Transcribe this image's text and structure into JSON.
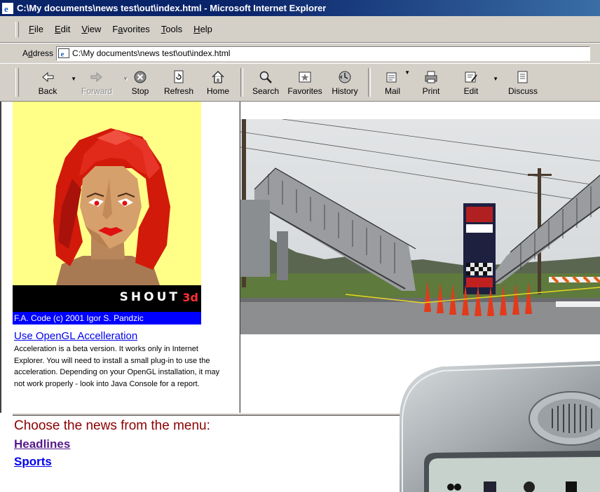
{
  "window": {
    "title": "C:\\My documents\\news test\\out\\index.html - Microsoft Internet Explorer"
  },
  "menubar": {
    "items": [
      {
        "accel": "F",
        "rest": "ile"
      },
      {
        "accel": "E",
        "rest": "dit"
      },
      {
        "accel": "V",
        "rest": "iew"
      },
      {
        "pre": "F",
        "accel": "a",
        "rest": "vorites"
      },
      {
        "accel": "T",
        "rest": "ools"
      },
      {
        "accel": "H",
        "rest": "elp"
      }
    ]
  },
  "address": {
    "label_pre": "A",
    "label_accel": "d",
    "label_rest": "dress",
    "url": "C:\\My documents\\news test\\out\\index.html"
  },
  "toolbar": {
    "back": "Back",
    "forward": "Forward",
    "stop": "Stop",
    "refresh": "Refresh",
    "home": "Home",
    "search": "Search",
    "favorites": "Favorites",
    "history": "History",
    "mail": "Mail",
    "print": "Print",
    "edit": "Edit",
    "discuss": "Discuss"
  },
  "left_frame": {
    "applet_logo": "SHOUT",
    "applet_logo_3d": "3d",
    "credit": "F.A. Code (c) 2001 Igor S. Pandzic",
    "opengl_link": "Use OpenGL Accelleration",
    "opengl_desc": "Acceleration is a beta version. It works only in Internet Explorer. You will need to install a small plug-in to use the acceleration. Depending on your OpenGL installation, it may not work properly - look into Java Console for a report."
  },
  "bottom_frame": {
    "menu_title": "Choose the news from the menu:",
    "links": [
      "Headlines",
      "Sports"
    ]
  },
  "colors": {
    "title_bar": "#0a246a",
    "chrome": "#d4d0c8",
    "link": "#0000ee",
    "visited": "#551a8b",
    "menu_title": "#8b0000",
    "applet_bg": "#ffff88"
  },
  "icons": [
    "ie-page-icon",
    "back-arrow-icon",
    "forward-arrow-icon",
    "stop-icon",
    "refresh-icon",
    "home-icon",
    "search-icon",
    "favorites-icon",
    "history-icon",
    "mail-icon",
    "print-icon",
    "edit-icon",
    "discuss-icon"
  ]
}
